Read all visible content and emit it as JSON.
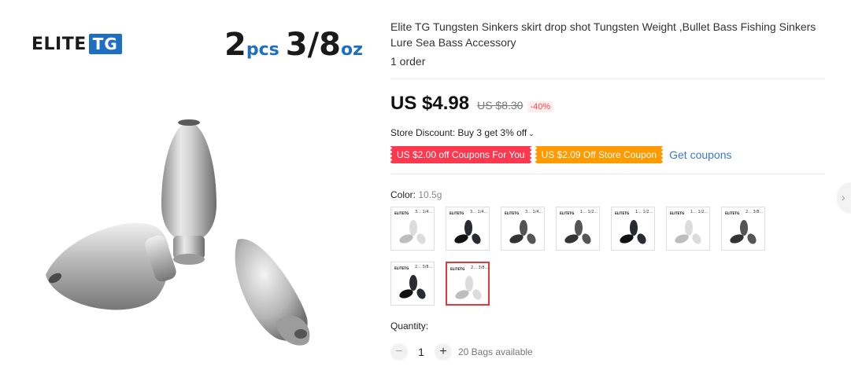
{
  "gallery": {
    "brand_main": "ELITE",
    "brand_accent": "TG",
    "pack_count": "2",
    "pack_count_unit": "pcs",
    "pack_weight": "3/8",
    "pack_weight_unit": "oz"
  },
  "product": {
    "title": "Elite TG Tungsten Sinkers skirt drop shot Tungsten Weight ,Bullet Bass Fishing Sinkers Lure Sea Bass Accessory",
    "orders": "1 order"
  },
  "pricing": {
    "price": "US $4.98",
    "original_price": "US $8.30",
    "discount": "-40%"
  },
  "store_discount": {
    "text": "Store Discount: Buy 3 get 3% off",
    "chevron_icon": "chevron-down-icon"
  },
  "coupons": {
    "coupon1": "US $2.00 off Coupons For You",
    "coupon2": "US $2.09 Off Store Coupon",
    "get_coupons": "Get coupons"
  },
  "variants": {
    "label": "Color:",
    "selected_value": "10.5g",
    "options": [
      {
        "caption": "3... 1/4...",
        "tone": "light"
      },
      {
        "caption": "3... 1/4...",
        "tone": "black"
      },
      {
        "caption": "3... 1/4...",
        "tone": "dark"
      },
      {
        "caption": "1... 1/2...",
        "tone": "dark"
      },
      {
        "caption": "1... 1/2...",
        "tone": "black"
      },
      {
        "caption": "1... 1/2...",
        "tone": "light"
      },
      {
        "caption": "2... 3/8...",
        "tone": "dark"
      },
      {
        "caption": "2... 3/8...",
        "tone": "black"
      },
      {
        "caption": "2... 3/8...",
        "tone": "light"
      }
    ],
    "swatch_brand": "ELITETG",
    "selected_index": 8
  },
  "quantity": {
    "label": "Quantity:",
    "minus": "−",
    "value": "1",
    "plus": "+",
    "available": "20 Bags available"
  },
  "colors": {
    "accent_red": "#ff4747",
    "coupon_red": "#fd384f",
    "coupon_orange": "#ff9a00",
    "link_blue": "#3a79c9",
    "brand_blue": "#1e6fc2"
  }
}
